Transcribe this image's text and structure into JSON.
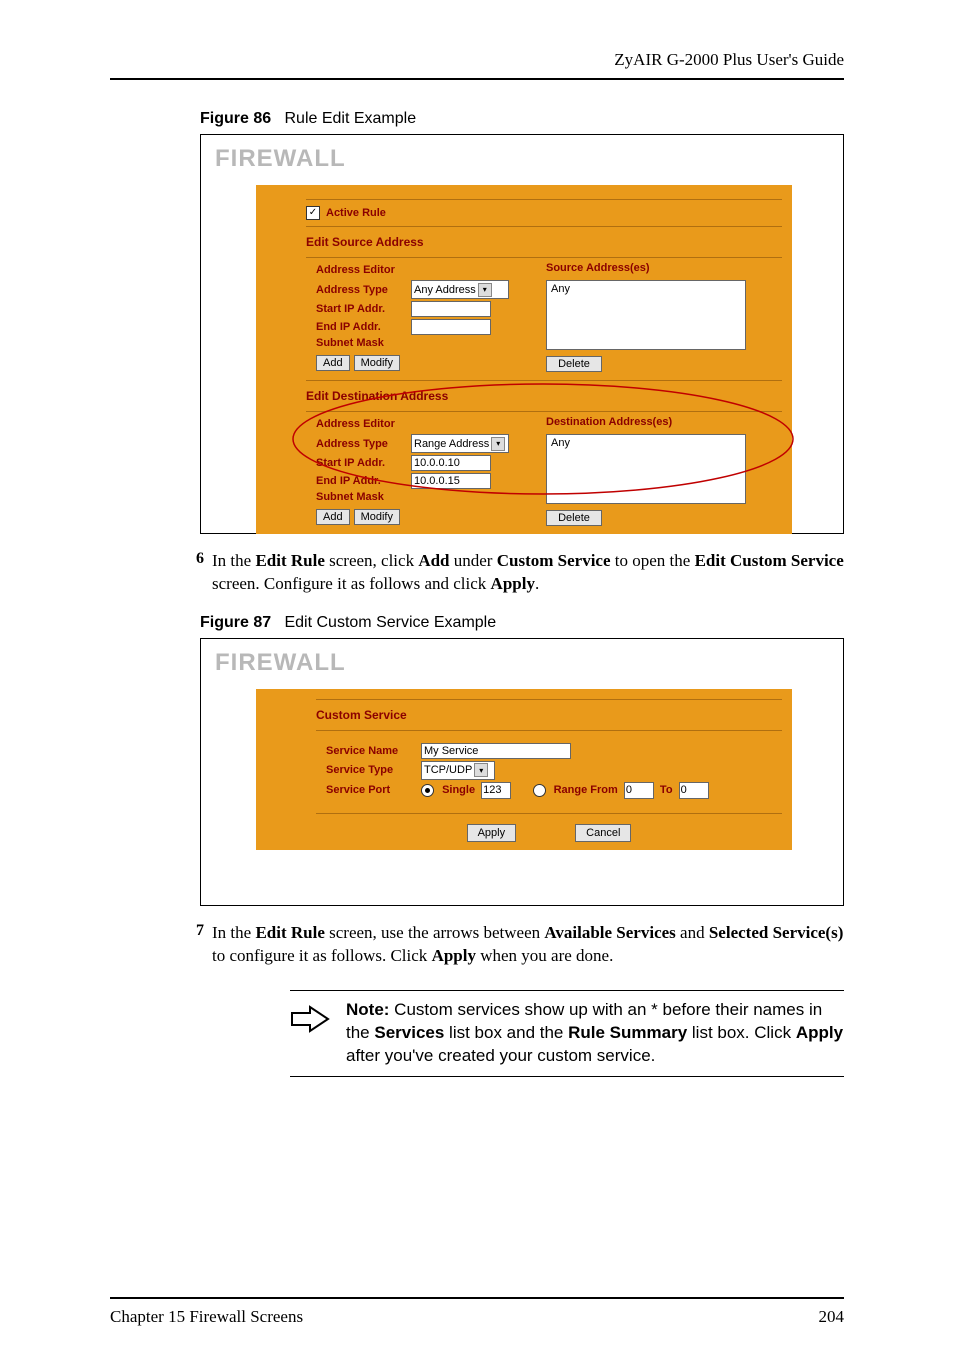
{
  "header": {
    "title": "ZyAIR G-2000 Plus User's Guide"
  },
  "figure86": {
    "label_prefix": "Figure 86",
    "label_rest": "Rule Edit Example",
    "title": "FIREWALL",
    "active_rule_label": "Active Rule",
    "src_section": "Edit Source Address",
    "dst_section": "Edit Destination Address",
    "addr_editor": "Address Editor",
    "address_type": "Address Type",
    "start_ip": "Start IP Addr.",
    "end_ip": "End IP Addr.",
    "subnet_mask": "Subnet Mask",
    "src_addresses_label": "Source Address(es)",
    "dst_addresses_label": "Destination Address(es)",
    "any_value": "Any",
    "sel_any_address": "Any Address",
    "sel_range_address": "Range Address",
    "start_val": "10.0.0.10",
    "end_val": "10.0.0.15",
    "btn_add": "Add",
    "btn_modify": "Modify",
    "btn_delete": "Delete"
  },
  "step6": {
    "num": "6",
    "t1": "In the ",
    "b1": "Edit Rule",
    "t2": " screen, click ",
    "b2": "Add",
    "t3": " under ",
    "b3": "Custom Service",
    "t4": " to open the ",
    "b4": "Edit Custom Service",
    "t5": " screen. Configure it as follows and click ",
    "b5": "Apply",
    "t6": "."
  },
  "figure87": {
    "label_prefix": "Figure 87",
    "label_rest": "Edit Custom Service Example",
    "title": "FIREWALL",
    "custom_service": "Custom Service",
    "service_name": "Service Name",
    "service_type": "Service Type",
    "service_port": "Service Port",
    "name_val": "My Service",
    "type_val": "TCP/UDP",
    "single_label": "Single",
    "single_val": "123",
    "range_from": "Range From",
    "range_to": "To",
    "range_from_val": "0",
    "range_to_val": "0",
    "apply": "Apply",
    "cancel": "Cancel"
  },
  "step7": {
    "num": "7",
    "t1": "In the ",
    "b1": "Edit Rule",
    "t2": " screen, use the arrows between ",
    "b2": "Available Services",
    "t3": " and ",
    "b3": "Selected Service(s)",
    "t4": " to configure it as follows. Click ",
    "b4": "Apply",
    "t5": " when you are done."
  },
  "note": {
    "b_note": "Note:",
    "t1": " Custom services show up with an * before their names in the ",
    "b1": "Services",
    "t2": " list box and the ",
    "b2": "Rule Summary",
    "t3": " list box. Click ",
    "b3": "Apply",
    "t4": " after you've created your custom service."
  },
  "footer": {
    "left": "Chapter 15 Firewall Screens",
    "right": "204"
  }
}
